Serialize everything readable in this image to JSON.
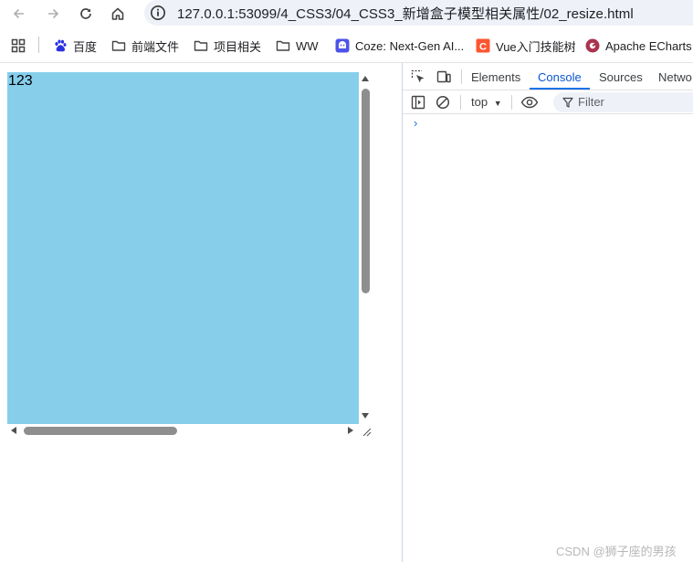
{
  "browser": {
    "url": "127.0.0.1:53099/4_CSS3/04_CSS3_新增盒子模型相关属性/02_resize.html",
    "bookmarks": [
      {
        "label": "百度",
        "icon": "baidu-paw-icon"
      },
      {
        "label": "前端文件",
        "icon": "folder-icon"
      },
      {
        "label": "项目相关",
        "icon": "folder-icon"
      },
      {
        "label": "WW",
        "icon": "folder-icon"
      },
      {
        "label": "Coze: Next-Gen AI...",
        "icon": "coze-icon"
      },
      {
        "label": "Vue入门技能树",
        "icon": "csdn-icon"
      },
      {
        "label": "Apache ECharts",
        "icon": "echarts-icon"
      }
    ]
  },
  "page": {
    "box_text": "123"
  },
  "devtools": {
    "tabs": [
      "Elements",
      "Console",
      "Sources",
      "Netwo"
    ],
    "active_tab": "Console",
    "context": "top",
    "filter_placeholder": "Filter",
    "prompt_symbol": "›"
  },
  "watermark": "CSDN @狮子座的男孩",
  "colors": {
    "box": "#87ceeb",
    "accent": "#1a73e8",
    "omnibox": "#eef1f8"
  }
}
